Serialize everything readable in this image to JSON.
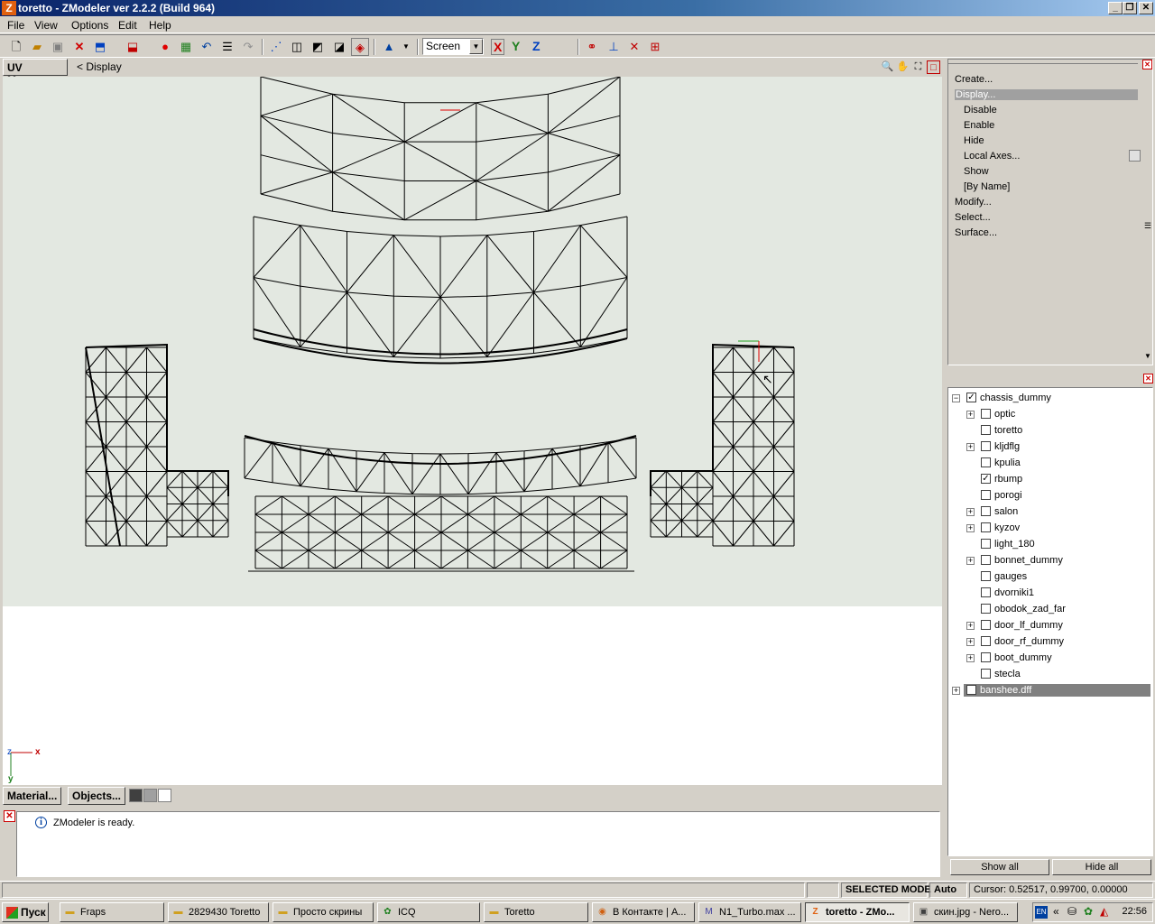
{
  "window": {
    "title": "toretto - ZModeler ver 2.2.2 (Build 964)",
    "minimize": "_",
    "restore": "❐",
    "close": "✕"
  },
  "menu": [
    "File",
    "View",
    "Options",
    "Edit",
    "Help"
  ],
  "toolbar": {
    "coord_mode": "Screen",
    "axis_x": "X",
    "axis_y": "Y",
    "axis_z": "Z"
  },
  "viewport": {
    "tab": "UV Mapper",
    "mode": "< Display",
    "axis_x": "x",
    "axis_y": "y",
    "axis_z": "z"
  },
  "viewport_buttons": {
    "materials": "Material...",
    "objects": "Objects..."
  },
  "log": {
    "message": "ZModeler is ready."
  },
  "commands": [
    {
      "label": "Create...",
      "indent": 0,
      "selected": false
    },
    {
      "label": "Display...",
      "indent": 0,
      "selected": true
    },
    {
      "label": "Disable",
      "indent": 1,
      "selected": false
    },
    {
      "label": "Enable",
      "indent": 1,
      "selected": false
    },
    {
      "label": "Hide",
      "indent": 1,
      "selected": false
    },
    {
      "label": "Local Axes...",
      "indent": 1,
      "selected": false
    },
    {
      "label": "Show",
      "indent": 1,
      "selected": false
    },
    {
      "label": "[By Name]",
      "indent": 1,
      "selected": false
    },
    {
      "label": "Modify...",
      "indent": 0,
      "selected": false
    },
    {
      "label": "Select...",
      "indent": 0,
      "selected": false
    },
    {
      "label": "Surface...",
      "indent": 0,
      "selected": false
    }
  ],
  "tree": [
    {
      "label": "chassis_dummy",
      "level": 0,
      "expander": "−",
      "checked": true
    },
    {
      "label": "optic",
      "level": 1,
      "expander": "+",
      "checked": false
    },
    {
      "label": "toretto",
      "level": 1,
      "expander": "",
      "checked": false
    },
    {
      "label": "kljdflg",
      "level": 1,
      "expander": "+",
      "checked": false
    },
    {
      "label": "kpulia",
      "level": 1,
      "expander": "",
      "checked": false
    },
    {
      "label": "rbump",
      "level": 1,
      "expander": "",
      "checked": true
    },
    {
      "label": "porogi",
      "level": 1,
      "expander": "",
      "checked": false
    },
    {
      "label": "salon",
      "level": 1,
      "expander": "+",
      "checked": false
    },
    {
      "label": "kyzov",
      "level": 1,
      "expander": "+",
      "checked": false
    },
    {
      "label": "light_180",
      "level": 1,
      "expander": "",
      "checked": false
    },
    {
      "label": "bonnet_dummy",
      "level": 1,
      "expander": "+",
      "checked": false
    },
    {
      "label": "gauges",
      "level": 1,
      "expander": "",
      "checked": false
    },
    {
      "label": "dvorniki1",
      "level": 1,
      "expander": "",
      "checked": false
    },
    {
      "label": "obodok_zad_far",
      "level": 1,
      "expander": "",
      "checked": false
    },
    {
      "label": "door_lf_dummy",
      "level": 1,
      "expander": "+",
      "checked": false
    },
    {
      "label": "door_rf_dummy",
      "level": 1,
      "expander": "+",
      "checked": false
    },
    {
      "label": "boot_dummy",
      "level": 1,
      "expander": "+",
      "checked": false
    },
    {
      "label": "stecla",
      "level": 1,
      "expander": "",
      "checked": false
    },
    {
      "label": "banshee.dff",
      "level": 0,
      "expander": "+",
      "checked": false,
      "selected": true
    }
  ],
  "tree_buttons": {
    "show_all": "Show all",
    "hide_all": "Hide all"
  },
  "status": {
    "mode": "SELECTED MODE",
    "auto": "Auto",
    "cursor": "Cursor: 0.52517, 0.99700, 0.00000"
  },
  "taskbar": {
    "start": "Пуск",
    "tasks": [
      {
        "label": "Fraps",
        "icon": "folder-icon",
        "active": false
      },
      {
        "label": "2829430 Toretto",
        "icon": "folder-icon",
        "active": false
      },
      {
        "label": "Просто скрины",
        "icon": "folder-icon",
        "active": false
      },
      {
        "label": "ICQ",
        "icon": "icq-icon",
        "active": false
      },
      {
        "label": "Toretto",
        "icon": "folder-icon",
        "active": false
      },
      {
        "label": "В Контакте | A...",
        "icon": "firefox-icon",
        "active": false
      },
      {
        "label": "N1_Turbo.max ...",
        "icon": "3dsmax-icon",
        "active": false
      },
      {
        "label": "toretto - ZMo...",
        "icon": "zmodeler-icon",
        "active": true
      },
      {
        "label": "скин.jpg - Nero...",
        "icon": "image-icon",
        "active": false
      }
    ],
    "lang": "EN",
    "clock": "22:56"
  }
}
